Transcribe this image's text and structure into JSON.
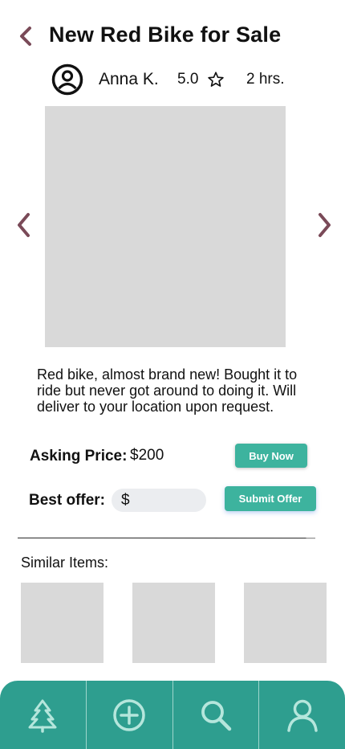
{
  "header": {
    "title": "New Red Bike for Sale"
  },
  "seller": {
    "name": "Anna K.",
    "rating": "5.0",
    "posted_ago": "2 hrs."
  },
  "listing": {
    "description": "Red bike, almost brand new! Bought it to ride but never got around to doing it. Will deliver to your location upon request.",
    "asking_price_label": "Asking Price:",
    "asking_price_value": "$200",
    "buy_button_label": "Buy Now",
    "best_offer_label": "Best offer:",
    "offer_currency": "$",
    "offer_input_value": "",
    "submit_offer_label": "Submit Offer"
  },
  "similar": {
    "title": "Similar Items:"
  },
  "nav": {
    "items": [
      {
        "icon": "tree-icon"
      },
      {
        "icon": "add-circle-icon"
      },
      {
        "icon": "search-icon"
      },
      {
        "icon": "profile-icon"
      }
    ]
  },
  "colors": {
    "accent": "#3db39e",
    "nav_background": "#2e9e8f",
    "nav_icon": "#b5e6dc",
    "chevron": "#7a4a58",
    "placeholder_image": "#d9d9d9"
  }
}
